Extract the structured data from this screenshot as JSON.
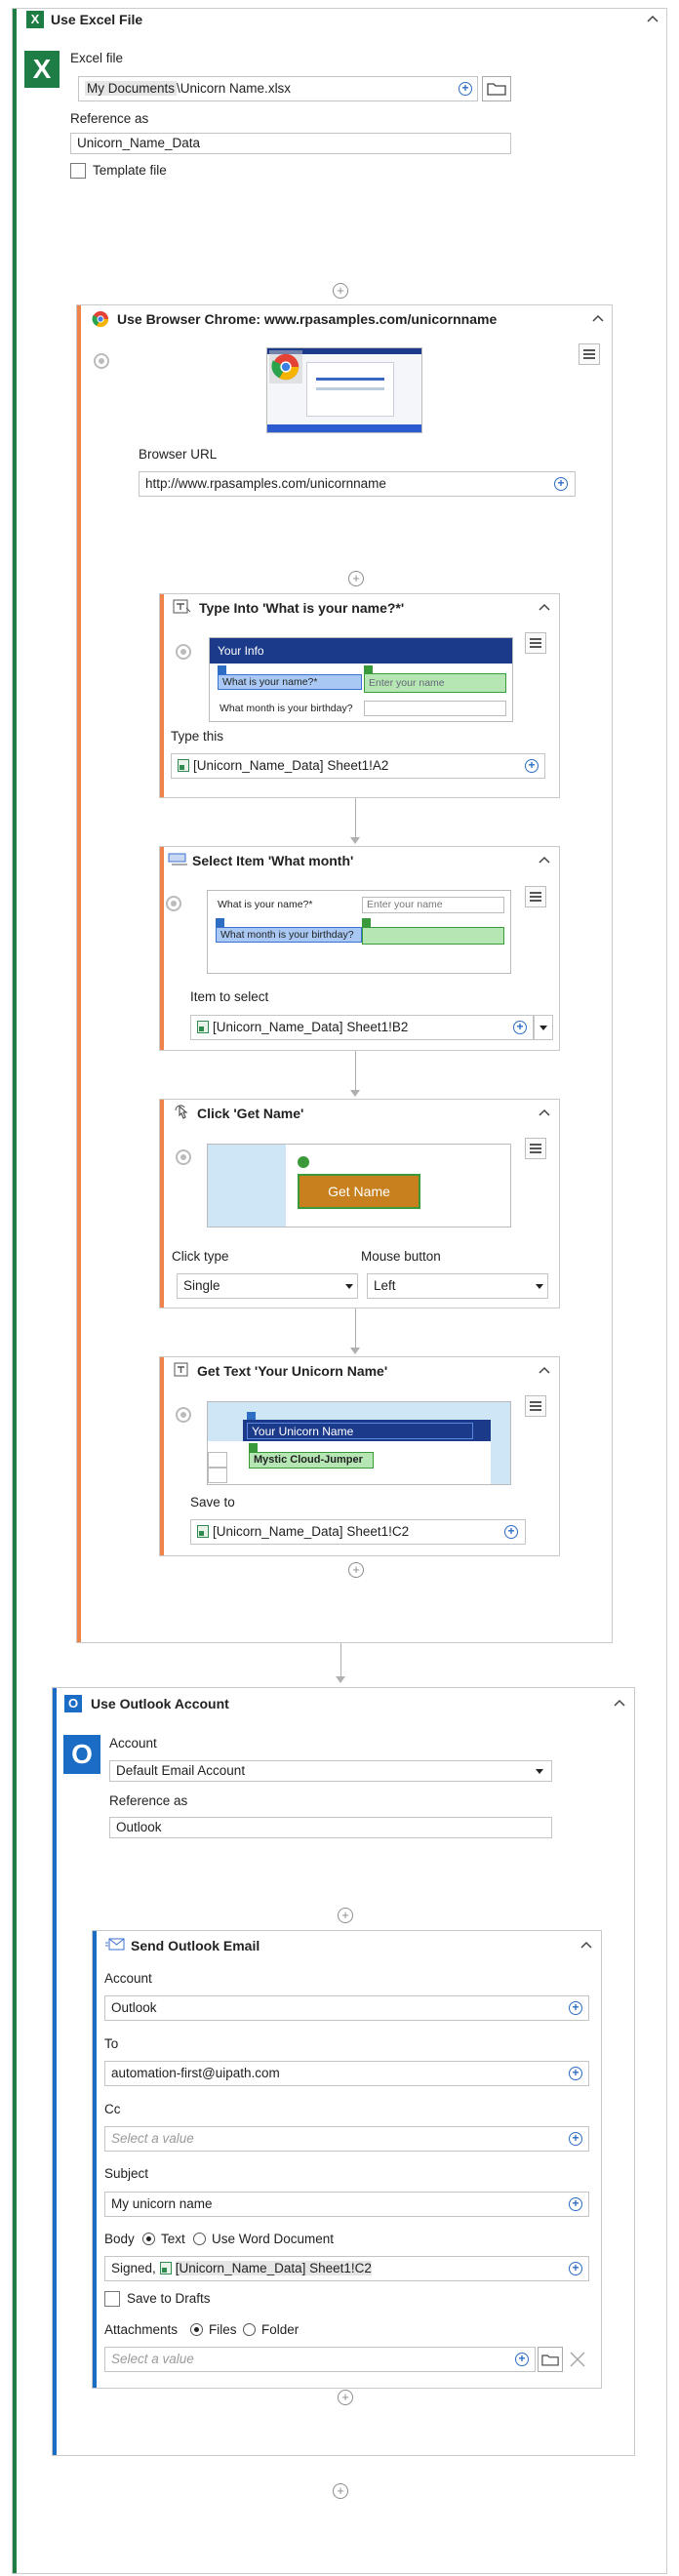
{
  "excel_scope": {
    "title": "Use Excel File",
    "icon_letter": "X",
    "file_label": "Excel file",
    "file_prefix": "My Documents",
    "file_name": "\\Unicorn Name.xlsx",
    "reference_label": "Reference as",
    "reference_value": "Unicorn_Name_Data",
    "template_label": "Template file"
  },
  "browser": {
    "title": "Use Browser Chrome: www.rpasamples.com/unicornname",
    "url_label": "Browser URL",
    "url_value": "http://www.rpasamples.com/unicornname"
  },
  "type_into": {
    "title": "Type Into 'What is your name?*'",
    "shot_header": "Your Info",
    "shot_q1": "What is your name?*",
    "shot_placeholder": "Enter your name",
    "shot_q2": "What month is your birthday?",
    "type_label": "Type this",
    "type_value": "[Unicorn_Name_Data] Sheet1!A2"
  },
  "select_item": {
    "title": "Select Item 'What month'",
    "shot_q1": "What is your name?*",
    "shot_placeholder": "Enter your name",
    "shot_q2": "What month is your birthday?",
    "item_label": "Item to select",
    "item_value": "[Unicorn_Name_Data] Sheet1!B2"
  },
  "click": {
    "title": "Click 'Get Name'",
    "shot_button": "Get Name",
    "type_label": "Click type",
    "type_value": "Single",
    "mouse_label": "Mouse button",
    "mouse_value": "Left"
  },
  "get_text": {
    "title": "Get Text 'Your Unicorn Name'",
    "shot_header": "Your Unicorn Name",
    "shot_result": "Mystic Cloud-Jumper",
    "save_label": "Save to",
    "save_value": "[Unicorn_Name_Data] Sheet1!C2"
  },
  "outlook_scope": {
    "title": "Use Outlook Account",
    "icon_letter": "O",
    "account_label": "Account",
    "account_value": "Default Email Account",
    "reference_label": "Reference as",
    "reference_value": "Outlook"
  },
  "send_mail": {
    "title": "Send Outlook Email",
    "account_label": "Account",
    "account_value": "Outlook",
    "to_label": "To",
    "to_value": "automation-first@uipath.com",
    "cc_label": "Cc",
    "cc_placeholder": "Select a value",
    "subject_label": "Subject",
    "subject_value": "My unicorn name",
    "body_label": "Body",
    "body_opt_text": "Text",
    "body_opt_word": "Use Word Document",
    "body_prefix": "Signed,",
    "body_value": "[Unicorn_Name_Data] Sheet1!C2",
    "drafts_label": "Save to Drafts",
    "attach_label": "Attachments",
    "attach_opt_files": "Files",
    "attach_opt_folder": "Folder",
    "attach_placeholder": "Select a value"
  },
  "colors": {
    "excel_green": "#1e7c45",
    "browser_orange": "#f0834a",
    "outlook_blue": "#1a6cc4",
    "accent_blue": "#2d6dc4"
  }
}
